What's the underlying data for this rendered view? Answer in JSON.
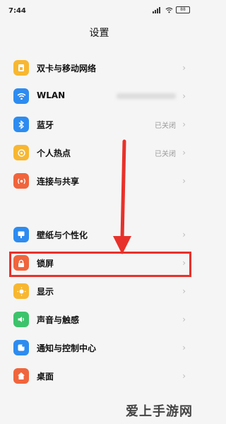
{
  "status_bar": {
    "time": "7:44",
    "signal": "ııl",
    "wifi": "≈",
    "battery": "88"
  },
  "page": {
    "title": "设置"
  },
  "settings_items": [
    {
      "label": "双卡与移动网络",
      "value": "",
      "icon": "sim-card-icon",
      "color": "#f7b731"
    },
    {
      "label": "WLAN",
      "value": "",
      "value_blurred": true,
      "icon": "wifi-icon",
      "color": "#2d8cf0"
    },
    {
      "label": "蓝牙",
      "value": "已关闭",
      "icon": "bluetooth-icon",
      "color": "#2d8cf0"
    },
    {
      "label": "个人热点",
      "value": "已关闭",
      "icon": "hotspot-icon",
      "color": "#f7b731"
    },
    {
      "label": "连接与共享",
      "value": "",
      "icon": "connection-icon",
      "color": "#f0653c"
    },
    {
      "label": "壁纸与个性化",
      "value": "",
      "icon": "wallpaper-icon",
      "color": "#2d8cf0"
    },
    {
      "label": "锁屏",
      "value": "",
      "icon": "lock-icon",
      "color": "#f0653c"
    },
    {
      "label": "显示",
      "value": "",
      "icon": "brightness-icon",
      "color": "#f7b731"
    },
    {
      "label": "声音与触感",
      "value": "",
      "icon": "sound-icon",
      "color": "#3cc36b"
    },
    {
      "label": "通知与控制中心",
      "value": "",
      "icon": "notification-icon",
      "color": "#2d8cf0"
    },
    {
      "label": "桌面",
      "value": "",
      "icon": "home-icon",
      "color": "#f0653c"
    }
  ],
  "chevron": "›",
  "annotation": {
    "highlight_color": "#e8312a"
  },
  "watermark": "爱上手游网"
}
